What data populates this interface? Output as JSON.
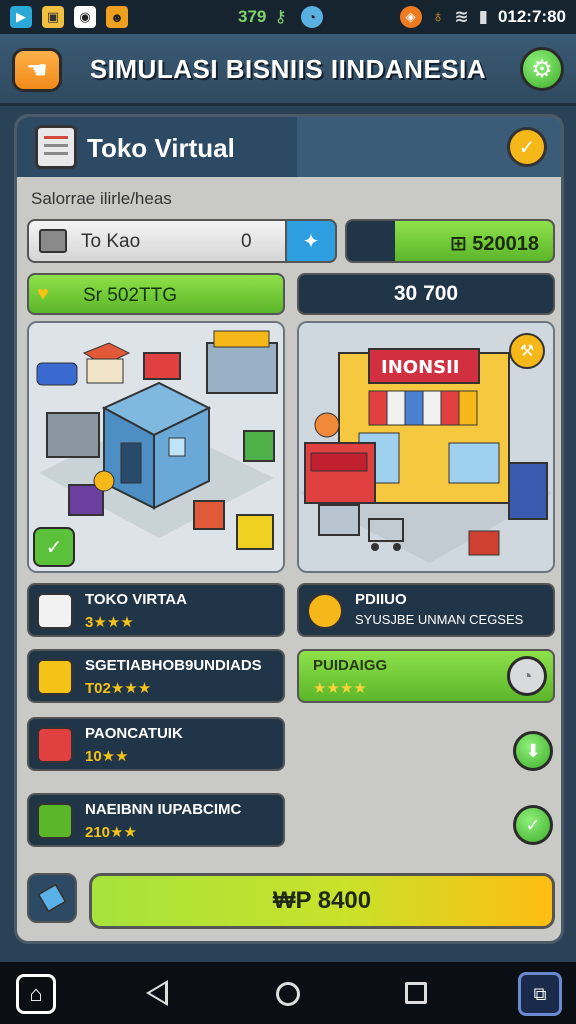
{
  "statusbar": {
    "num": "379",
    "time": "012:7:80",
    "left_icons": [
      "youtube-icon",
      "image-icon",
      "camera-icon",
      "game-icon"
    ],
    "right_icons": [
      "alarm-icon",
      "wifi-icon",
      "signal-icon",
      "battery-icon"
    ]
  },
  "header": {
    "title": "SIMULASI BISNIIS IINDANESIA",
    "back_icon": "hand-pointer-icon",
    "settings_icon": "gear-icon"
  },
  "panel": {
    "title": "Toko Virtual",
    "subtitle": "Salorrae ilirle/heas",
    "row1": {
      "label": "To Kao",
      "value": "0",
      "plus": "✦",
      "right_value": "⊞ 520018"
    },
    "row2": {
      "label": "Sr 502TTG",
      "right_value": "30 700"
    },
    "scene_right_sign": "INONSII",
    "items": [
      {
        "name": "TOKO VIRTAA",
        "stars": "3★★★"
      },
      {
        "name": "PDIIUO",
        "desc": "SYUSJBE UNMAN CEGSES"
      },
      {
        "name": "SGETIABHOB9UNDIADS",
        "stars": "T02★★★"
      },
      {
        "name": "PUIDAIGG",
        "stars": "★★★★"
      },
      {
        "name": "PAONCATUIK",
        "stars": "10★★"
      },
      {
        "name": "NAEIBNN IUPABCIMC",
        "stars": "210★★"
      }
    ],
    "price_button": "₩P 8400"
  },
  "colors": {
    "accent_green": "#5cb62a",
    "panel_dark": "#213548",
    "gold": "#f5b818"
  }
}
